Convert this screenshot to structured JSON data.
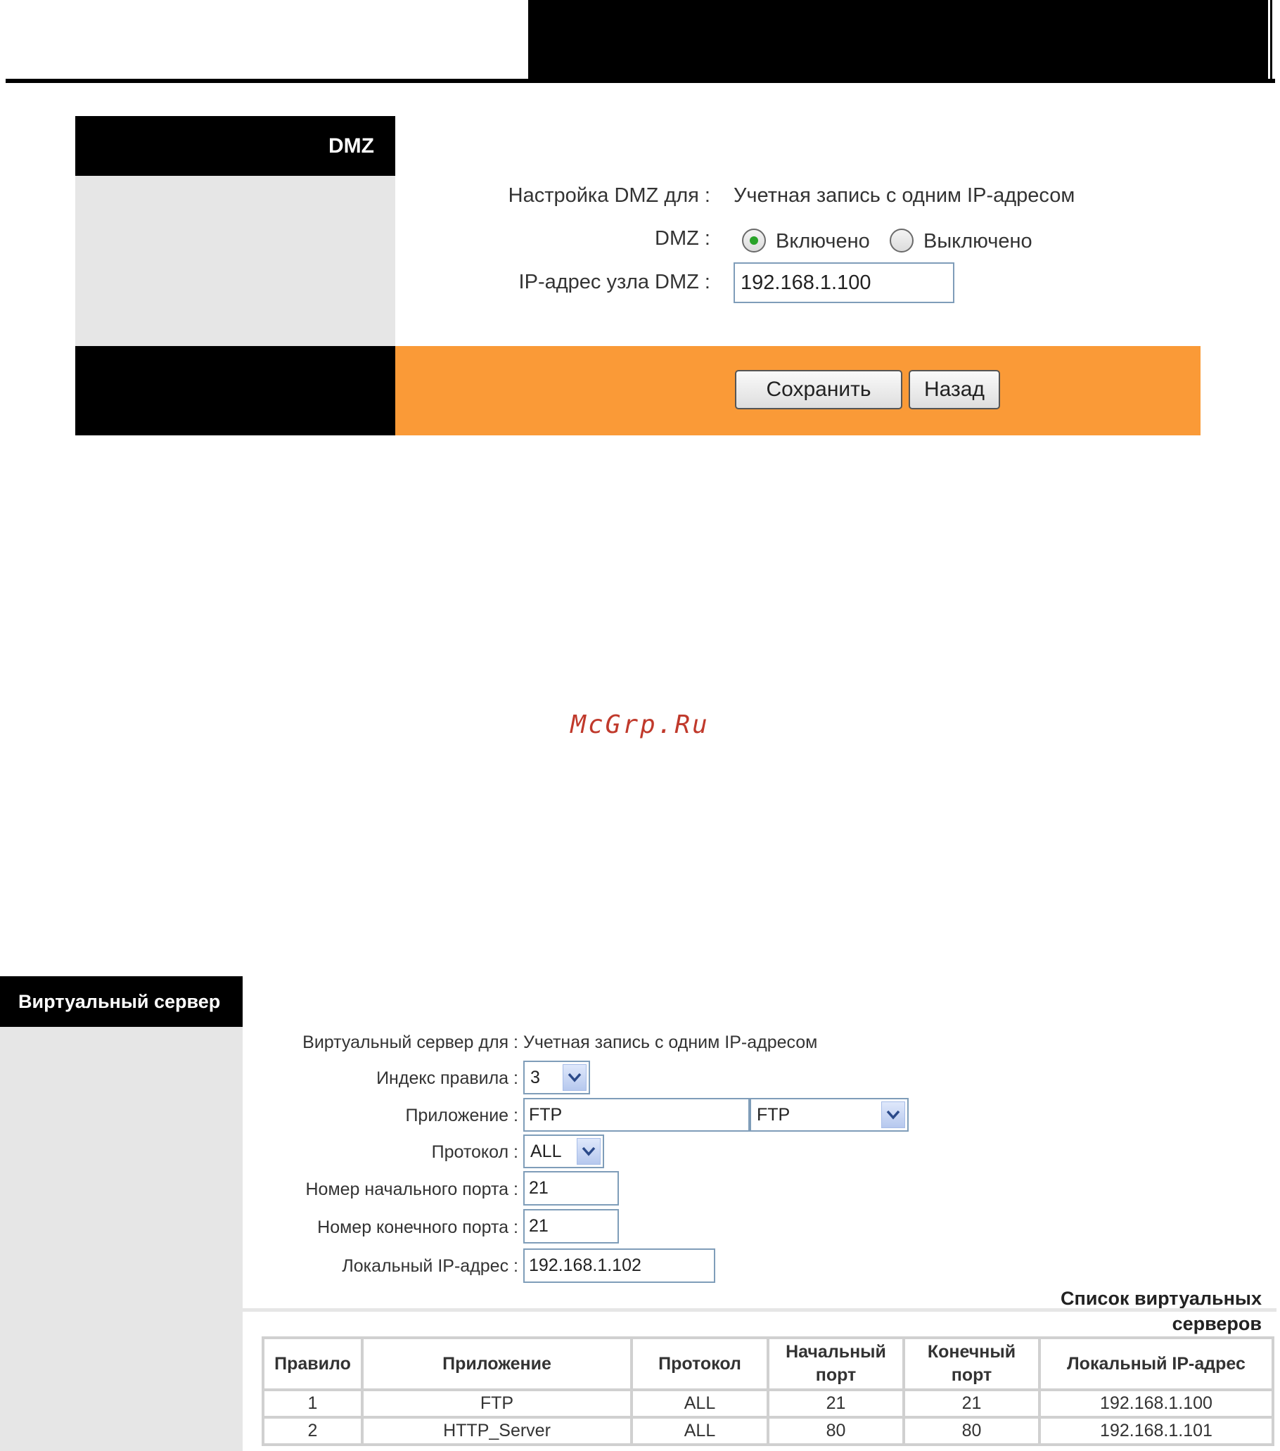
{
  "dmz": {
    "title": "DMZ",
    "setup_label": "Настройка DMZ для",
    "setup_value": "Учетная запись с одним IP-адресом",
    "dmz_label": "DMZ",
    "enabled_label": "Включено",
    "disabled_label": "Выключено",
    "selected": "enabled",
    "ip_label": "IP-адрес узла DMZ",
    "ip_value": "192.168.1.100",
    "save_label": "Сохранить",
    "back_label": "Назад"
  },
  "watermark": "McGrp.Ru",
  "virtual_server": {
    "title": "Виртуальный сервер",
    "for_label": "Виртуальный сервер для",
    "for_value": "Учетная запись с одним IP-адресом",
    "rule_index_label": "Индекс правила",
    "rule_index_value": "3",
    "application_label": "Приложение",
    "application_input": "FTP",
    "application_select": "FTP",
    "protocol_label": "Протокол",
    "protocol_value": "ALL",
    "start_port_label": "Номер начального порта",
    "start_port_value": "21",
    "end_port_label": "Номер конечного порта",
    "end_port_value": "21",
    "local_ip_label": "Локальный IP-адрес",
    "local_ip_value": "192.168.1.102",
    "list_title_line1": "Список виртуальных",
    "list_title_line2": "серверов",
    "table": {
      "headers": [
        "Правило",
        "Приложение",
        "Протокол",
        "Начальный",
        "порт",
        "Конечный",
        "порт",
        "Локальный IP-адрес"
      ],
      "rows": [
        [
          "1",
          "FTP",
          "ALL",
          "21",
          "21",
          "192.168.1.100"
        ],
        [
          "2",
          "HTTP_Server",
          "ALL",
          "80",
          "80",
          "192.168.1.101"
        ]
      ]
    }
  }
}
